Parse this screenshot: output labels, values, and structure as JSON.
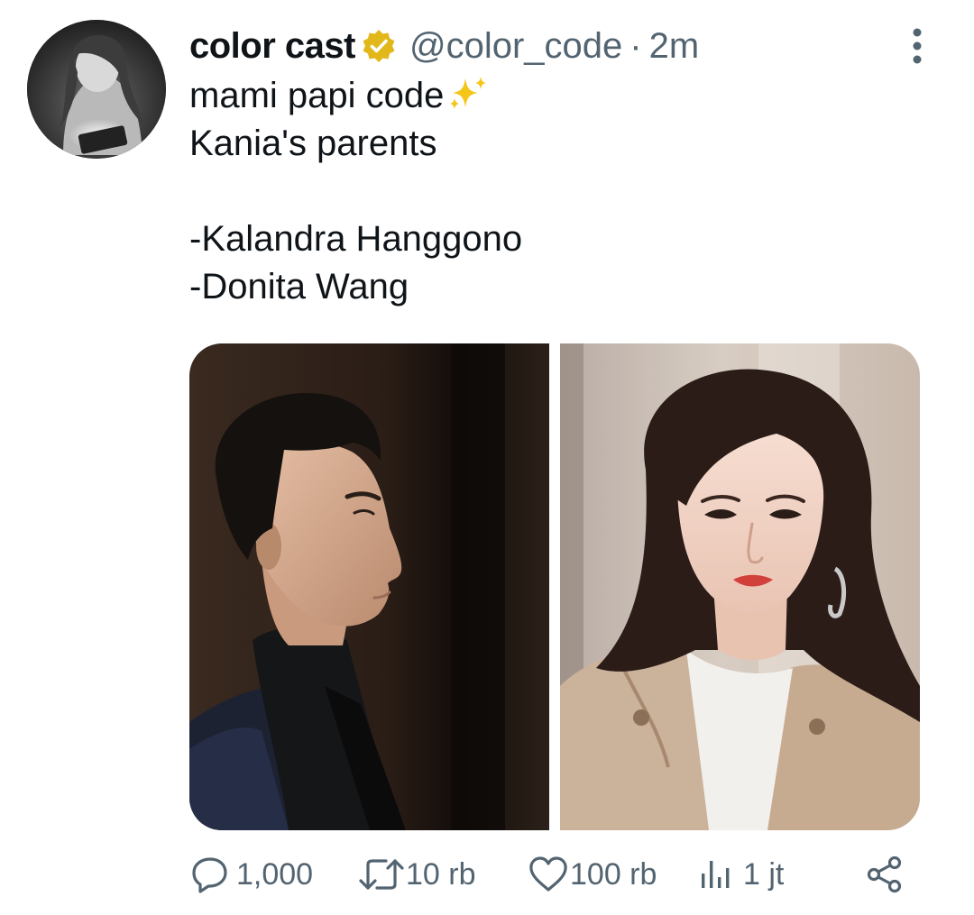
{
  "tweet": {
    "author": {
      "display_name": "color cast",
      "verified_icon": "verified-badge-gold",
      "handle": "@color_code",
      "separator": "·",
      "timestamp": "2m"
    },
    "text_lines": [
      "mami papi code",
      "Kania's parents",
      "",
      "-Kalandra Hanggono",
      "-Donita Wang"
    ],
    "sparkle_emoji": "✨",
    "media": [
      {
        "alt_icon": "photo-man-profile"
      },
      {
        "alt_icon": "photo-woman-portrait"
      }
    ],
    "actions": {
      "replies": "1,000",
      "retweets": "10 rb",
      "likes": "100 rb",
      "views": "1 jt"
    },
    "colors": {
      "text": "#0f1419",
      "muted": "#536471",
      "verified": "#e2b719"
    }
  }
}
